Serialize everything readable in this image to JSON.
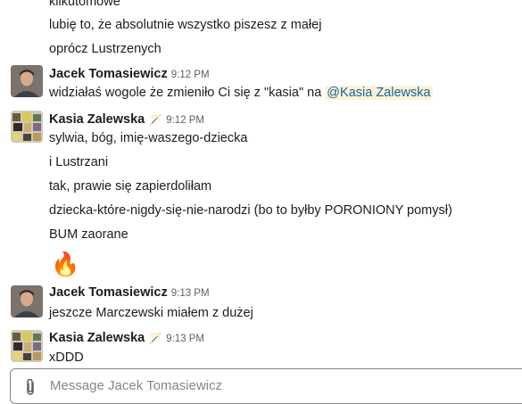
{
  "messages": {
    "top_fragment": "kilkutomowe",
    "m1": "lubię to, że absolutnie wszystko piszesz z małej",
    "m2": "oprócz Lustrzenych",
    "g1": {
      "author": "Jacek Tomasiewicz",
      "time": "9:12 PM",
      "text_before": "widziałaś wogole że zmieniło Ci się z \"kasia\" na ",
      "mention": "@Kasia Zalewska"
    },
    "g2": {
      "author": "Kasia Zalewska",
      "status_emoji": "🪄",
      "time": "9:12 PM",
      "lines": [
        "sylwia, bóg, imię-waszego-dziecka",
        "i Lustrzani",
        "tak, prawie się zapierdoliłam",
        "dziecka-które-nigdy-się-nie-narodzi (bo to byłby PORONIONY pomysł)",
        "BUM zaorane"
      ],
      "emoji": "🔥"
    },
    "g3": {
      "author": "Jacek Tomasiewicz",
      "time": "9:13 PM",
      "text": "jeszcze Marczewski miałem z dużej"
    },
    "g4": {
      "author": "Kasia Zalewska",
      "status_emoji": "🪄",
      "time": "9:13 PM",
      "text": "xDDD"
    }
  },
  "composer": {
    "placeholder": "Message Jacek Tomasiewicz",
    "attach_icon": "paperclip-icon"
  }
}
